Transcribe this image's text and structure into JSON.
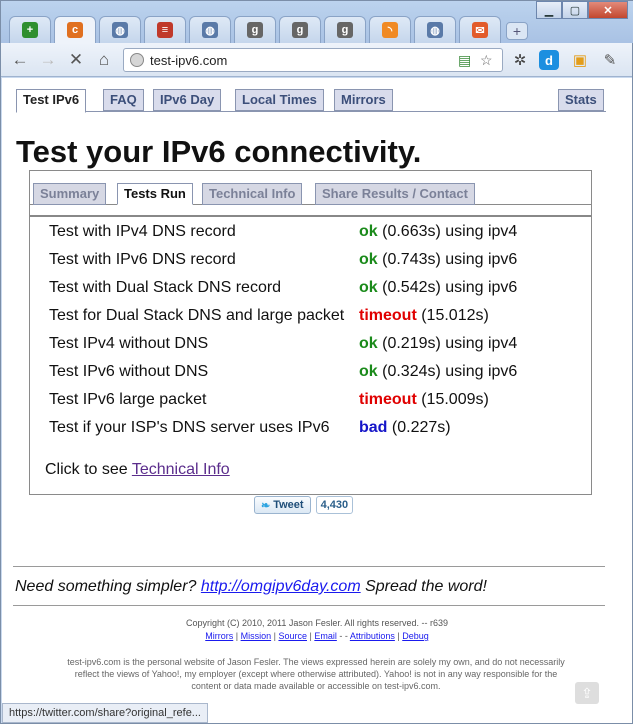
{
  "browser": {
    "tabs": [
      {
        "icon": "green-plus-icon",
        "color": "#2f8f2f",
        "glyph": "+"
      },
      {
        "icon": "orange-c-icon",
        "color": "#e07020",
        "glyph": "c"
      },
      {
        "icon": "globe-icon",
        "color": "#5a7aa8",
        "glyph": "◍"
      },
      {
        "icon": "us-flag-icon",
        "color": "#c0392b",
        "glyph": "≡"
      },
      {
        "icon": "globe-icon",
        "color": "#5a7aa8",
        "glyph": "◍"
      },
      {
        "icon": "g-icon",
        "color": "#666666",
        "glyph": "g"
      },
      {
        "icon": "g-icon",
        "color": "#666666",
        "glyph": "g"
      },
      {
        "icon": "g-icon",
        "color": "#666666",
        "glyph": "g"
      },
      {
        "icon": "rss-icon",
        "color": "#f08a24",
        "glyph": "◝"
      },
      {
        "icon": "globe-icon",
        "color": "#5a7aa8",
        "glyph": "◍"
      },
      {
        "icon": "mail-icon",
        "color": "#e25b2b",
        "glyph": "✉"
      }
    ],
    "new_tab_glyph": "+",
    "url": "test-ipv6.com",
    "status_text": "https://twitter.com/share?original_refe..."
  },
  "site_nav": {
    "tabs": [
      "Test IPv6",
      "FAQ",
      "IPv6 Day",
      "Local Times",
      "Mirrors"
    ],
    "stats_label": "Stats"
  },
  "page": {
    "title": "Test your IPv6 connectivity."
  },
  "panel": {
    "tabs": [
      "Summary",
      "Tests Run",
      "Technical Info",
      "Share Results / Contact"
    ],
    "results": [
      {
        "test": "Test with IPv4 DNS record",
        "status": "ok",
        "detail": " (0.663s) using ipv4"
      },
      {
        "test": "Test with IPv6 DNS record",
        "status": "ok",
        "detail": " (0.743s) using ipv6"
      },
      {
        "test": "Test with Dual Stack DNS record",
        "status": "ok",
        "detail": " (0.542s) using ipv6"
      },
      {
        "test": "Test for Dual Stack DNS and large packet",
        "status": "timeout",
        "detail": " (15.012s)"
      },
      {
        "test": "Test IPv4 without DNS",
        "status": "ok",
        "detail": " (0.219s) using ipv4"
      },
      {
        "test": "Test IPv6 without DNS",
        "status": "ok",
        "detail": " (0.324s) using ipv6"
      },
      {
        "test": "Test IPv6 large packet",
        "status": "timeout",
        "detail": " (15.009s)"
      },
      {
        "test": "Test if your ISP's DNS server uses IPv6",
        "status": "bad",
        "detail": " (0.227s)"
      }
    ],
    "click_prefix": "Click to see ",
    "click_link": "Technical Info"
  },
  "tweet": {
    "label": "Tweet",
    "count": "4,430"
  },
  "footer": {
    "simpler_prefix": "Need something simpler? ",
    "simpler_link": "http://omgipv6day.com",
    "simpler_suffix": " Spread the word!",
    "copyright": "Copyright (C) 2010, 2011 Jason Fesler. All rights reserved. -- r639",
    "links": [
      "Mirrors",
      "Mission",
      "Source",
      "Email",
      "Attributions",
      "Debug"
    ],
    "disclaimer_lines": [
      "test-ipv6.com is the personal website of Jason Fesler. The views expressed herein are solely my own, and do not necessarily",
      "reflect the views of Yahoo!, my employer (except where otherwise attributed). Yahoo! is not in any way responsible for the",
      "content or data made available or accessible on test-ipv6.com."
    ]
  },
  "colors": {
    "ok": "#1a8a1a",
    "timeout": "#e00000",
    "bad": "#1414c8",
    "link": "#1a1aee"
  }
}
